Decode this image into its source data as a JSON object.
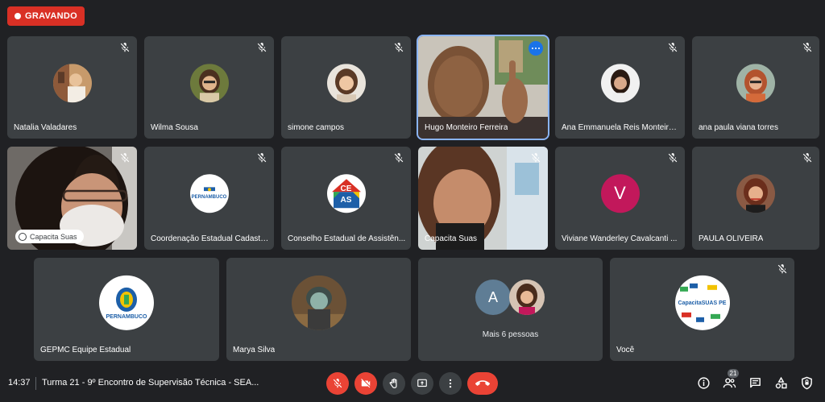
{
  "recording": {
    "label": "GRAVANDO"
  },
  "tiles": {
    "natalia": {
      "name": "Natalia Valadares"
    },
    "wilma": {
      "name": "Wilma Sousa"
    },
    "simone": {
      "name": "simone campos"
    },
    "hugo": {
      "name": "Hugo Monteiro Ferreira"
    },
    "ana_emmanuela": {
      "name": "Ana Emmanuela Reis Monteiro ..."
    },
    "ana_paula": {
      "name": "ana paula viana torres"
    },
    "capacita_pinned": {
      "badge": "Capacita Suas"
    },
    "coordenacao": {
      "name": "Coordenação Estadual Cadastr...",
      "logo_text": "PERNAMBUCO"
    },
    "conselho": {
      "name": "Conselho Estadual de Assistên...",
      "logo_top": "CE",
      "logo_bottom": "AS"
    },
    "capacita": {
      "name": "Capacita Suas"
    },
    "viviane": {
      "name": "Viviane Wanderley Cavalcanti ...",
      "initial": "V",
      "color": "#c2185b"
    },
    "paula": {
      "name": "PAULA OLIVEIRA"
    },
    "gepmc": {
      "name": "GEPMC Equipe Estadual",
      "logo_text": "PERNAMBUCO"
    },
    "marya": {
      "name": "Marya Silva"
    },
    "mais": {
      "label": "Mais 6 pessoas",
      "initial": "A",
      "color": "#5f7d95"
    },
    "voce": {
      "name": "Você",
      "logo_text": "CapacitaSUAS PE"
    }
  },
  "bottom_bar": {
    "time": "14:37",
    "meeting_title": "Turma 21 - 9º Encontro de Supervisão Técnica - SEA...",
    "participants_count": "21",
    "controls": [
      "mic-off-icon",
      "camera-off-icon",
      "raise-hand-icon",
      "present-icon",
      "more-options-icon",
      "hang-up-icon"
    ],
    "right_icons": [
      "info-icon",
      "people-icon",
      "chat-icon",
      "activities-icon",
      "host-controls-icon"
    ]
  }
}
